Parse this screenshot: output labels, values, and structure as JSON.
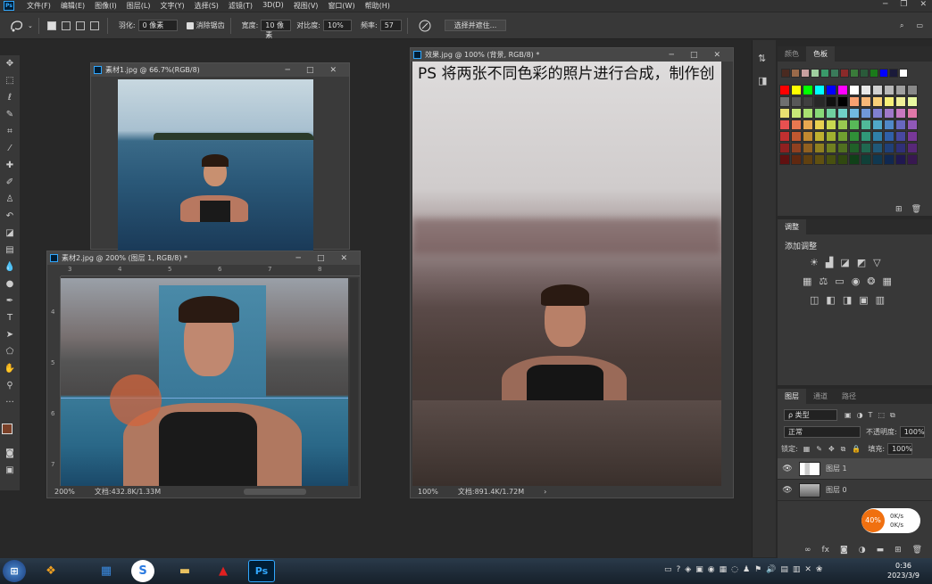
{
  "app": {
    "logo": "Ps"
  },
  "menu": [
    "文件(F)",
    "编辑(E)",
    "图像(I)",
    "图层(L)",
    "文字(Y)",
    "选择(S)",
    "滤镜(T)",
    "3D(D)",
    "视图(V)",
    "窗口(W)",
    "帮助(H)"
  ],
  "options": {
    "feather_label": "羽化:",
    "feather_value": "0 像素",
    "antialias_label": "消除锯齿",
    "width_label": "宽度:",
    "width_value": "10 像素",
    "contrast_label": "对比度:",
    "contrast_value": "10%",
    "freq_label": "频率:",
    "freq_value": "57",
    "select_mask": "选择并遮住..."
  },
  "doc1": {
    "title": "素材1.jpg @ 66.7%(RGB/8)"
  },
  "doc2": {
    "title": "素材2.jpg @ 200% (图层 1, RGB/8) *",
    "zoom": "200%",
    "docsize": "文档:432.8K/1.33M",
    "ruler": [
      "3",
      "4",
      "5",
      "6",
      "7",
      "8"
    ],
    "vruler": [
      "4",
      "5",
      "6",
      "7"
    ]
  },
  "doc3": {
    "title": "效果.jpg @ 100% (背景, RGB/8) *",
    "zoom": "100%",
    "docsize": "文档:891.4K/1.72M"
  },
  "caption": "PS 将两张不同色彩的照片进行合成，制作创",
  "swatch_panel": {
    "tabs": [
      "颜色",
      "色板"
    ],
    "recent": [
      "#4a2a20",
      "#9a6a4a",
      "#c8a0a0",
      "#a0d0a0",
      "#3a9a6a",
      "#3a7a5a",
      "#8a2a2a",
      "#3a7a3a",
      "#2a5a3a",
      "#1a7a1a",
      "#0000ff",
      "#1a1a3a",
      "#ffffff"
    ],
    "grid": [
      [
        "#ff0000",
        "#ffff00",
        "#00ff00",
        "#00ffff",
        "#0000ff",
        "#ff00ff",
        "#ffffff",
        "#e8e8e8",
        "#d0d0d0",
        "#b8b8b8",
        "#a0a0a0",
        "#888888"
      ],
      [
        "#707070",
        "#585858",
        "#404040",
        "#282828",
        "#101010",
        "#000000",
        "#f8a070",
        "#f8b878",
        "#f8d078",
        "#f8f078",
        "#f0f098",
        "#e8f8a0"
      ],
      [
        "#e8e070",
        "#c8e878",
        "#a8e070",
        "#88d878",
        "#70d0a0",
        "#70d0c8",
        "#70b8e0",
        "#7098d8",
        "#8080d0",
        "#a078c8",
        "#c878c0",
        "#e078a8"
      ],
      [
        "#e85050",
        "#e87850",
        "#e8a850",
        "#e8d050",
        "#c8d850",
        "#98c850",
        "#58b858",
        "#50b898",
        "#50a8c8",
        "#5088c8",
        "#6868c0",
        "#9058b8"
      ],
      [
        "#c03030",
        "#c05830",
        "#c08830",
        "#c0b030",
        "#a0b030",
        "#70a030",
        "#309038",
        "#309878",
        "#3080a8",
        "#3060a8",
        "#4848a0",
        "#783898"
      ],
      [
        "#902020",
        "#904020",
        "#906020",
        "#908020",
        "#708020",
        "#507020",
        "#206028",
        "#206850",
        "#205878",
        "#204078",
        "#303078",
        "#582878"
      ],
      [
        "#601010",
        "#602810",
        "#604010",
        "#605010",
        "#485010",
        "#304810",
        "#104018",
        "#104038",
        "#103850",
        "#102850",
        "#201850",
        "#381850"
      ]
    ]
  },
  "adjust_panel": {
    "tab": "调整",
    "title": "添加调整"
  },
  "layers_panel": {
    "tabs": [
      "图层",
      "通道",
      "路径"
    ],
    "kind": "ρ 类型",
    "blend": "正常",
    "opacity_label": "不透明度:",
    "opacity": "100%",
    "lock_label": "锁定:",
    "fill_label": "填充:",
    "fill": "100%",
    "layers": [
      "图层 1",
      "图层 0"
    ]
  },
  "net": {
    "percent": "40%",
    "up": "0K/s",
    "down": "0K/s"
  },
  "taskbar": {
    "time": "0:36",
    "date": "2023/3/9"
  }
}
